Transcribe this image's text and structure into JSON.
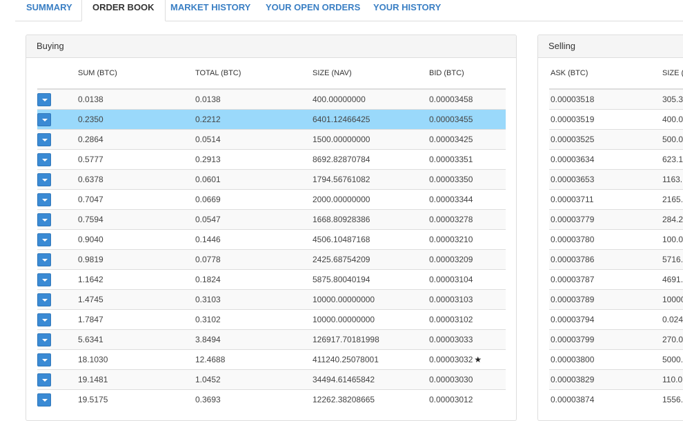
{
  "tabs": [
    {
      "label": "SUMMARY",
      "active": false
    },
    {
      "label": "ORDER BOOK",
      "active": true
    },
    {
      "label": "MARKET HISTORY",
      "active": false
    },
    {
      "label": "YOUR OPEN ORDERS",
      "active": false
    },
    {
      "label": "YOUR HISTORY",
      "active": false
    }
  ],
  "buying": {
    "title": "Buying",
    "columns": [
      "SUM (BTC)",
      "TOTAL (BTC)",
      "SIZE (NAV)",
      "BID (BTC)"
    ],
    "highlight_color": "#9ad9fb",
    "rows": [
      {
        "sum": "0.0138",
        "total": "0.0138",
        "size": "400.00000000",
        "bid": "0.00003458"
      },
      {
        "sum": "0.2350",
        "total": "0.2212",
        "size": "6401.12466425",
        "bid": "0.00003455",
        "highlighted": true
      },
      {
        "sum": "0.2864",
        "total": "0.0514",
        "size": "1500.00000000",
        "bid": "0.00003425"
      },
      {
        "sum": "0.5777",
        "total": "0.2913",
        "size": "8692.82870784",
        "bid": "0.00003351"
      },
      {
        "sum": "0.6378",
        "total": "0.0601",
        "size": "1794.56761082",
        "bid": "0.00003350"
      },
      {
        "sum": "0.7047",
        "total": "0.0669",
        "size": "2000.00000000",
        "bid": "0.00003344"
      },
      {
        "sum": "0.7594",
        "total": "0.0547",
        "size": "1668.80928386",
        "bid": "0.00003278"
      },
      {
        "sum": "0.9040",
        "total": "0.1446",
        "size": "4506.10487168",
        "bid": "0.00003210"
      },
      {
        "sum": "0.9819",
        "total": "0.0778",
        "size": "2425.68754209",
        "bid": "0.00003209"
      },
      {
        "sum": "1.1642",
        "total": "0.1824",
        "size": "5875.80040194",
        "bid": "0.00003104"
      },
      {
        "sum": "1.4745",
        "total": "0.3103",
        "size": "10000.00000000",
        "bid": "0.00003103"
      },
      {
        "sum": "1.7847",
        "total": "0.3102",
        "size": "10000.00000000",
        "bid": "0.00003102"
      },
      {
        "sum": "5.6341",
        "total": "3.8494",
        "size": "126917.70181998",
        "bid": "0.00003033"
      },
      {
        "sum": "18.1030",
        "total": "12.4688",
        "size": "411240.25078001",
        "bid": "0.00003032",
        "star": "★"
      },
      {
        "sum": "19.1481",
        "total": "1.0452",
        "size": "34494.61465842",
        "bid": "0.00003030"
      },
      {
        "sum": "19.5175",
        "total": "0.3693",
        "size": "12262.38208665",
        "bid": "0.00003012"
      }
    ]
  },
  "selling": {
    "title": "Selling",
    "columns": [
      "ASK (BTC)",
      "SIZE ("
    ],
    "rows": [
      {
        "ask": "0.00003518",
        "size": "305.3"
      },
      {
        "ask": "0.00003519",
        "size": "400.0"
      },
      {
        "ask": "0.00003525",
        "size": "500.0"
      },
      {
        "ask": "0.00003634",
        "size": "623.1"
      },
      {
        "ask": "0.00003653",
        "size": "1163."
      },
      {
        "ask": "0.00003711",
        "size": "2165."
      },
      {
        "ask": "0.00003779",
        "size": "284.2"
      },
      {
        "ask": "0.00003780",
        "size": "100.0"
      },
      {
        "ask": "0.00003786",
        "size": "5716."
      },
      {
        "ask": "0.00003787",
        "size": "4691."
      },
      {
        "ask": "0.00003789",
        "size": "10000"
      },
      {
        "ask": "0.00003794",
        "size": "0.024"
      },
      {
        "ask": "0.00003799",
        "size": "270.0"
      },
      {
        "ask": "0.00003800",
        "size": "5000."
      },
      {
        "ask": "0.00003829",
        "size": "110.0"
      },
      {
        "ask": "0.00003874",
        "size": "1556."
      }
    ]
  },
  "colors": {
    "tab_link": "#3a7fc4",
    "button_blue": "#3a8ad4",
    "row_highlight": "#9ad9fb"
  },
  "icons": {
    "row_button": "chevron-down-icon",
    "own_order": "star-icon"
  }
}
